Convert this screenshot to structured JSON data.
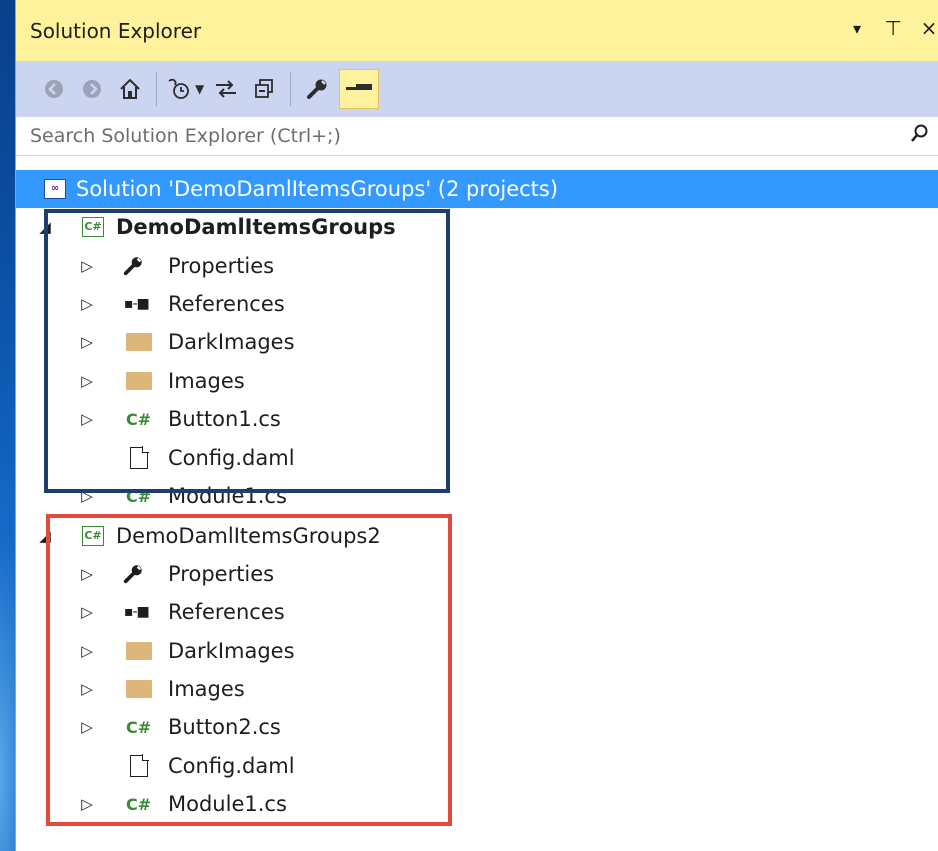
{
  "window": {
    "title": "Solution Explorer",
    "dropdown_glyph": "▾",
    "pin_glyph": "⊥",
    "close_glyph": "×"
  },
  "toolbar": {
    "back_icon": "back-icon",
    "forward_icon": "forward-icon",
    "home_icon": "home-icon",
    "pending_changes_icon": "pending-changes-icon",
    "sync_icon": "sync-with-active-document-icon",
    "collapse_all_icon": "collapse-all-icon",
    "properties_icon": "wrench-icon",
    "preview_icon": "preview-selected-items-icon"
  },
  "search": {
    "placeholder": "Search Solution Explorer (Ctrl+;)",
    "value": ""
  },
  "tree": {
    "solution": {
      "label": "Solution 'DemoDamlItemsGroups' (2 projects)"
    },
    "projects": [
      {
        "name": "DemoDamlItemsGroups",
        "bold": true,
        "items": [
          {
            "type": "properties",
            "label": "Properties",
            "expandable": true
          },
          {
            "type": "references",
            "label": "References",
            "expandable": true
          },
          {
            "type": "folder",
            "label": "DarkImages",
            "expandable": true
          },
          {
            "type": "folder",
            "label": "Images",
            "expandable": true
          },
          {
            "type": "cs",
            "label": "Button1.cs",
            "expandable": true
          },
          {
            "type": "file",
            "label": "Config.daml",
            "expandable": false
          },
          {
            "type": "cs",
            "label": "Module1.cs",
            "expandable": true
          }
        ]
      },
      {
        "name": "DemoDamlItemsGroups2",
        "bold": false,
        "items": [
          {
            "type": "properties",
            "label": "Properties",
            "expandable": true
          },
          {
            "type": "references",
            "label": "References",
            "expandable": true
          },
          {
            "type": "folder",
            "label": "DarkImages",
            "expandable": true
          },
          {
            "type": "folder",
            "label": "Images",
            "expandable": true
          },
          {
            "type": "cs",
            "label": "Button2.cs",
            "expandable": true
          },
          {
            "type": "file",
            "label": "Config.daml",
            "expandable": false
          },
          {
            "type": "cs",
            "label": "Module1.cs",
            "expandable": true
          }
        ]
      }
    ]
  },
  "colors": {
    "title_bar": "#fff29d",
    "toolbar": "#ccd5f0",
    "selection": "#3399ff",
    "highlight_blue": "#1d3f6e",
    "highlight_red": "#e04a3f"
  }
}
